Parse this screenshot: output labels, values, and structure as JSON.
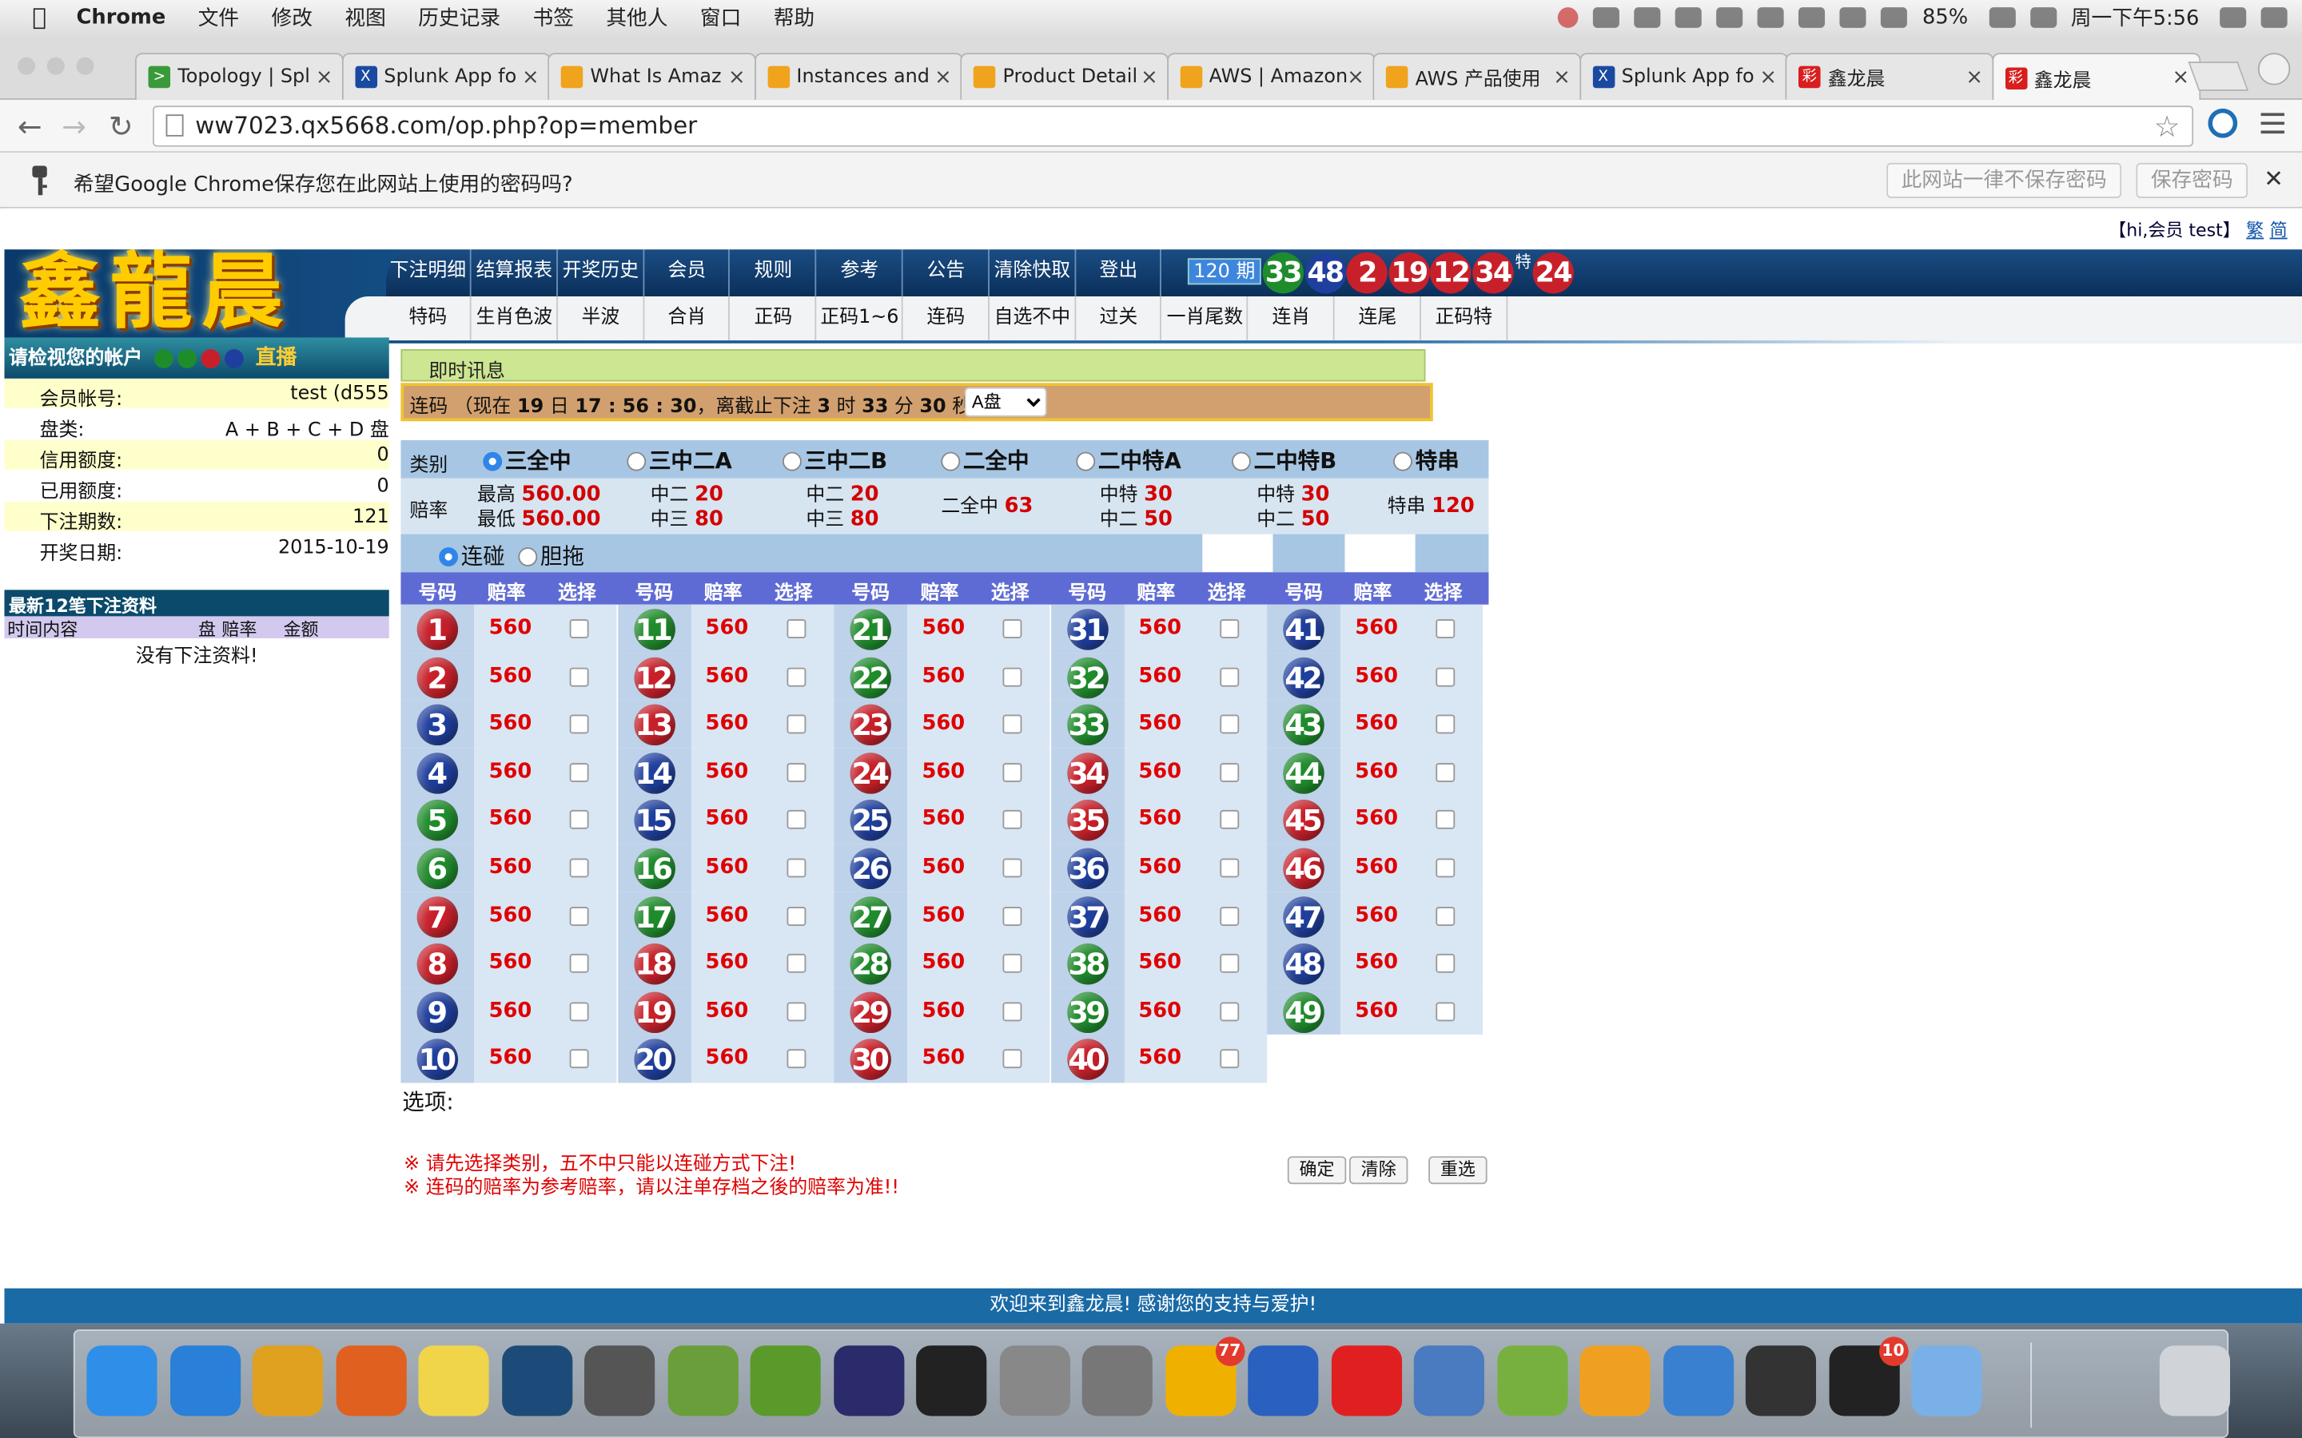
{
  "menubar": {
    "app": "Chrome",
    "items": [
      "文件",
      "修改",
      "视图",
      "历史记录",
      "书签",
      "其他人",
      "窗口",
      "帮助"
    ],
    "battery": "85%",
    "clock": "周一下午5:56"
  },
  "tabs": [
    {
      "title": "Topology | Spl",
      "fav_color": "#3a9a3a",
      "fav_text": ">"
    },
    {
      "title": "Splunk App fo",
      "fav_color": "#1a4aa0",
      "fav_text": "X"
    },
    {
      "title": "What Is Amaz",
      "fav_color": "#f0a31c",
      "fav_text": ""
    },
    {
      "title": "Instances and",
      "fav_color": "#f0a31c",
      "fav_text": ""
    },
    {
      "title": "Product Detail",
      "fav_color": "#f0a31c",
      "fav_text": ""
    },
    {
      "title": "AWS | Amazon",
      "fav_color": "#f0a31c",
      "fav_text": ""
    },
    {
      "title": "AWS 产品使用",
      "fav_color": "#f0a31c",
      "fav_text": ""
    },
    {
      "title": "Splunk App fo",
      "fav_color": "#1a4aa0",
      "fav_text": "X"
    },
    {
      "title": "鑫龙晨",
      "fav_color": "#d81e1e",
      "fav_text": "彩"
    },
    {
      "title": "鑫龙晨",
      "fav_color": "#d81e1e",
      "fav_text": "彩"
    }
  ],
  "url": "ww7023.qx5668.com/op.php?op=member",
  "password_bar": {
    "message": "希望Google Chrome保存您在此网站上使用的密码吗?",
    "never_label": "此网站一律不保存密码",
    "save_label": "保存密码"
  },
  "site": {
    "greeting": "【hi,会员 test】",
    "lang_trad": "繁",
    "lang_simp": "简",
    "logo": "鑫龍晨",
    "nav_top": [
      "下注明细",
      "结算报表",
      "开奖历史",
      "会员",
      "规则",
      "参考",
      "公告",
      "清除快取",
      "登出"
    ],
    "nav_bottom": [
      "特码",
      "生肖色波",
      "半波",
      "合肖",
      "正码",
      "正码1~6",
      "连码",
      "自选不中",
      "过关",
      "一肖尾数",
      "连肖",
      "连尾",
      "正码特"
    ],
    "period": "120 期",
    "draw_balls": [
      {
        "n": "33",
        "color": "green"
      },
      {
        "n": "48",
        "color": "blue"
      },
      {
        "n": "2",
        "color": "red"
      },
      {
        "n": "19",
        "color": "red"
      },
      {
        "n": "12",
        "color": "red"
      },
      {
        "n": "34",
        "color": "red"
      }
    ],
    "special_label": "特",
    "special_ball": {
      "n": "24",
      "color": "red"
    },
    "account": {
      "header": "请检视您的帐户",
      "live_label": "直播",
      "rows": [
        {
          "k": "会员帐号:",
          "v": "test (d555"
        },
        {
          "k": "盘类:",
          "v": "A + B + C + D 盘"
        },
        {
          "k": "信用额度:",
          "v": "0"
        },
        {
          "k": "已用额度:",
          "v": "0"
        },
        {
          "k": "下注期数:",
          "v": "121"
        },
        {
          "k": "开奖日期:",
          "v": "2015-10-19"
        }
      ]
    },
    "recent": {
      "header": "最新12笔下注资料",
      "cols": [
        "时间内容",
        "盘",
        "赔率",
        "金额"
      ],
      "empty": "没有下注资料!"
    },
    "info_title": "即时讯息",
    "status": {
      "prefix": "连码 （现在",
      "day": "19",
      "day_unit": "日",
      "time": "17 : 56 : 30",
      "mid": "，离截止下注",
      "h": "3",
      "m": "33",
      "s": "30",
      "h_unit": "时",
      "m_unit": "分",
      "s_unit": "秒）",
      "pan": "A盘"
    },
    "category_label": "类别",
    "odds_label": "赔率",
    "categories": [
      "三全中",
      "三中二A",
      "三中二B",
      "二全中",
      "二中特A",
      "二中特B",
      "特串"
    ],
    "odds_text": {
      "c1_l1": "最高",
      "c1_v1": "560.00",
      "c1_l2": "最低",
      "c1_v2": "560.00",
      "c2_l1": "中二",
      "c2_v1": "20",
      "c2_l2": "中三",
      "c2_v2": "80",
      "c3_l1": "中二",
      "c3_v1": "20",
      "c3_l2": "中三",
      "c3_v2": "80",
      "c4_l1": "二全中",
      "c4_v1": "63",
      "c5_l1": "中特",
      "c5_v1": "30",
      "c5_l2": "中二",
      "c5_v2": "50",
      "c6_l1": "中特",
      "c6_v1": "30",
      "c6_l2": "中二",
      "c6_v2": "50",
      "c7_l1": "特串",
      "c7_v1": "120"
    },
    "mode_a": "连碰",
    "mode_b": "胆拖",
    "grid_headers": [
      "号码",
      "赔率",
      "选择"
    ],
    "odds_value": "560",
    "ball_colors": {
      "1": "red",
      "2": "red",
      "3": "blue",
      "4": "blue",
      "5": "green",
      "6": "green",
      "7": "red",
      "8": "red",
      "9": "blue",
      "10": "blue",
      "11": "green",
      "12": "red",
      "13": "red",
      "14": "blue",
      "15": "blue",
      "16": "green",
      "17": "green",
      "18": "red",
      "19": "red",
      "20": "blue",
      "21": "green",
      "22": "green",
      "23": "red",
      "24": "red",
      "25": "blue",
      "26": "blue",
      "27": "green",
      "28": "green",
      "29": "red",
      "30": "red",
      "31": "blue",
      "32": "green",
      "33": "green",
      "34": "red",
      "35": "red",
      "36": "blue",
      "37": "blue",
      "38": "green",
      "39": "green",
      "40": "red",
      "41": "blue",
      "42": "blue",
      "43": "green",
      "44": "green",
      "45": "red",
      "46": "red",
      "47": "blue",
      "48": "blue",
      "49": "green"
    },
    "options_label": "选项:",
    "note1": "※ 请先选择类别，五不中只能以连碰方式下注!",
    "note2": "※ 连码的赔率为参考赔率，请以注单存档之後的赔率为准!!",
    "btn_ok": "确定",
    "btn_clear": "清除",
    "btn_reset": "重选",
    "footer": "欢迎来到鑫龙晨! 感谢您的支持与爱护!"
  },
  "dock": {
    "apps": [
      {
        "name": "finder",
        "color": "#2f8ee8"
      },
      {
        "name": "safari",
        "color": "#2a7fd8"
      },
      {
        "name": "chrome",
        "color": "#e0a020"
      },
      {
        "name": "firefox",
        "color": "#e06020"
      },
      {
        "name": "stickies",
        "color": "#f0d44a"
      },
      {
        "name": "sourcetree",
        "color": "#1d4b79"
      },
      {
        "name": "sublime",
        "color": "#555"
      },
      {
        "name": "filezilla1",
        "color": "#6a9e3a"
      },
      {
        "name": "filezilla2",
        "color": "#5a9a2a"
      },
      {
        "name": "eclipse",
        "color": "#2b2a6a"
      },
      {
        "name": "terminal",
        "color": "#222"
      },
      {
        "name": "mou",
        "color": "#888"
      },
      {
        "name": "preferences",
        "color": "#777"
      },
      {
        "name": "opera",
        "color": "#f0b000"
      },
      {
        "name": "messages",
        "color": "#2a60c0"
      },
      {
        "name": "netease",
        "color": "#e02020"
      },
      {
        "name": "virtualbox",
        "color": "#4a7ac0"
      },
      {
        "name": "android-studio",
        "color": "#78b040"
      },
      {
        "name": "sketch",
        "color": "#f0a020"
      },
      {
        "name": "xcode",
        "color": "#3a80d0"
      },
      {
        "name": "parallels",
        "color": "#333"
      },
      {
        "name": "qq",
        "color": "#222"
      },
      {
        "name": "app-store",
        "color": "#7ab0e8"
      },
      {
        "name": "trash",
        "color": "#d0d4d8"
      }
    ],
    "opera_badge": "77",
    "qq_badge": "10"
  }
}
